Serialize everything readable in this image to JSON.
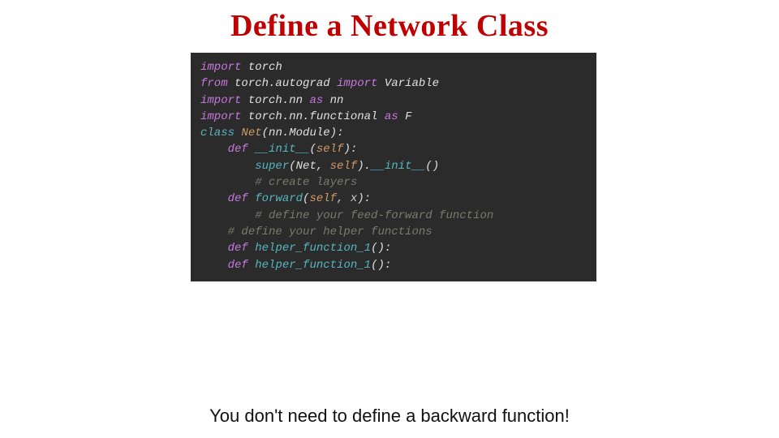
{
  "title": "Define a Network Class",
  "caption": "You don't need to define a backward function!",
  "code": {
    "l0": {
      "a": "import",
      "b": " torch"
    },
    "l1": {
      "a": "from",
      "b": " torch.autograd ",
      "c": "import",
      "d": " Variable"
    },
    "l2": {
      "a": "import",
      "b": " torch.nn ",
      "c": "as",
      "d": " nn"
    },
    "l3": {
      "a": "import",
      "b": " torch.nn.functional ",
      "c": "as",
      "d": " F"
    },
    "blank": "",
    "l5": {
      "a": "class",
      "b": " ",
      "c": "Net",
      "d": "(",
      "e": "nn.Module",
      "f": "):"
    },
    "l7": {
      "indent": "    ",
      "a": "def",
      "b": " ",
      "c": "__init__",
      "d": "(",
      "e": "self",
      "f": "):"
    },
    "l8": {
      "indent": "        ",
      "a": "super",
      "b": "(Net, ",
      "c": "self",
      "d": ").",
      "e": "__init__",
      "f": "()"
    },
    "l9": {
      "indent": "        ",
      "a": "# create layers"
    },
    "l11": {
      "indent": "    ",
      "a": "def",
      "b": " ",
      "c": "forward",
      "d": "(",
      "e": "self",
      "f": ", x",
      "g": "):"
    },
    "l12": {
      "indent": "        ",
      "a": "# define your feed-forward function"
    },
    "l14": {
      "indent": "    ",
      "a": "# define your helper functions"
    },
    "l15": {
      "indent": "    ",
      "a": "def",
      "b": " ",
      "c": "helper_function_1",
      "d": "():"
    },
    "l18": {
      "indent": "    ",
      "a": "def",
      "b": " ",
      "c": "helper_function_1",
      "d": "():"
    }
  }
}
